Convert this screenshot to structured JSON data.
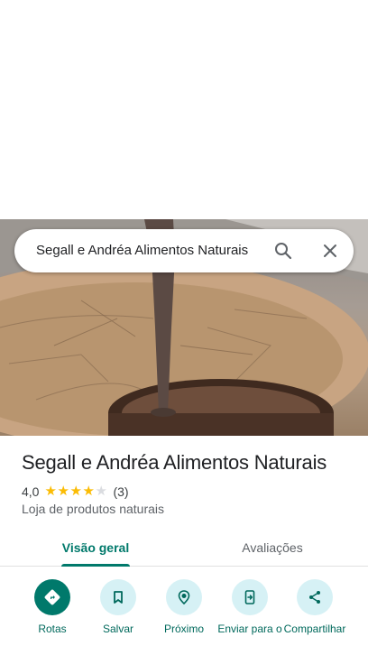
{
  "search": {
    "query": "Segall e Andréa Alimentos Naturais"
  },
  "place": {
    "name": "Segall e Andréa Alimentos Naturais",
    "rating": "4,0",
    "stars_filled": 4,
    "stars_total": 5,
    "review_count": "(3)",
    "category": "Loja de produtos naturais"
  },
  "tabs": [
    {
      "label": "Visão geral",
      "selected": true
    },
    {
      "label": "Avaliações",
      "selected": false
    }
  ],
  "actions": [
    {
      "label": "Rotas",
      "icon": "directions-icon"
    },
    {
      "label": "Salvar",
      "icon": "bookmark-icon"
    },
    {
      "label": "Próximo",
      "icon": "nearby-icon"
    },
    {
      "label": "Enviar para o",
      "icon": "send-to-phone-icon"
    },
    {
      "label": "Compartilhar",
      "icon": "share-icon"
    }
  ],
  "colors": {
    "accent": "#00796b",
    "action_bg": "#d6f1f5",
    "star": "#fbbc04"
  }
}
